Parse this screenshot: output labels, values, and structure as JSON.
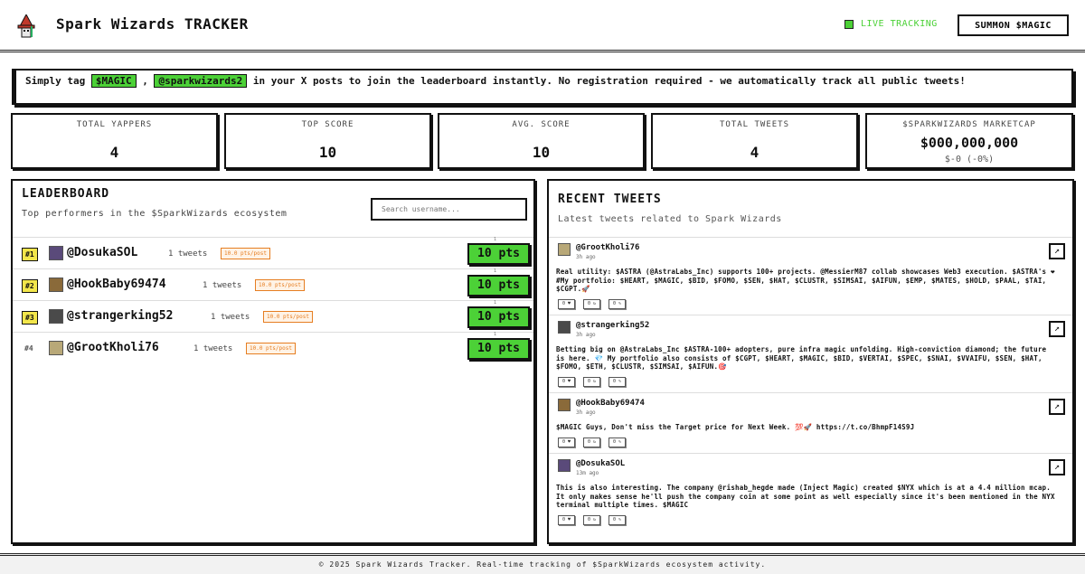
{
  "header": {
    "title": "Spark Wizards TRACKER",
    "live_label": "LIVE TRACKING",
    "summon_label": "SUMMON $MAGIC",
    "logo_icon": "wizard-icon"
  },
  "banner": {
    "part1": "Simply tag",
    "tag1": "$MAGIC",
    "sep": ",",
    "tag2": "@sparkwizards2",
    "part2": "in your X posts to join the leaderboard instantly. No registration required - we automatically track all public tweets!"
  },
  "stats": [
    {
      "label": "TOTAL YAPPERS",
      "value": "4"
    },
    {
      "label": "TOP SCORE",
      "value": "10"
    },
    {
      "label": "AVG. SCORE",
      "value": "10"
    },
    {
      "label": "TOTAL TWEETS",
      "value": "4"
    }
  ],
  "marketcap": {
    "label": "$SPARKWIZARDS MARKETCAP",
    "value": "$000,000,000",
    "change": "$-0 (-0%)"
  },
  "leaderboard": {
    "title": "LEADERBOARD",
    "subtitle": "Top performers in the $SparkWizards ecosystem",
    "search_placeholder": "Search username...",
    "rows": [
      {
        "rank": "#1",
        "user": "@DosukaSOL",
        "tweets": "1 tweets",
        "ppp": "10.0 pts/post",
        "pts": "10 pts",
        "tick": "1"
      },
      {
        "rank": "#2",
        "user": "@HookBaby69474",
        "tweets": "1 tweets",
        "ppp": "10.0 pts/post",
        "pts": "10 pts",
        "tick": "1"
      },
      {
        "rank": "#3",
        "user": "@strangerking52",
        "tweets": "1 tweets",
        "ppp": "10.0 pts/post",
        "pts": "10 pts",
        "tick": "1"
      },
      {
        "rank": "#4",
        "user": "@GrootKholi76",
        "tweets": "1 tweets",
        "ppp": "10.0 pts/post",
        "pts": "10 pts",
        "tick": "1"
      }
    ]
  },
  "recent": {
    "title": "RECENT TWEETS",
    "subtitle": "Latest tweets related to Spark Wizards",
    "tweets": [
      {
        "user": "@GrootKholi76",
        "time": "3h ago",
        "text": "Real utility: $ASTRA (@AstraLabs_Inc) supports 100+ projects. @MessierM87 collab showcases Web3 execution. $ASTRA's ❤ #My portfolio: $HEART, $MAGIC, $BID, $FOMO, $SEN, $HAT, $CLUSTR, $SIMSAI, $AIFUN, $EMP, $MATES, $HOLD, $PAAL, $TAI, $CGPT.🚀",
        "acts": [
          "0 ♥",
          "0 ↻",
          "0 ✎"
        ]
      },
      {
        "user": "@strangerking52",
        "time": "3h ago",
        "text": "Betting big on @AstraLabs_Inc $ASTRA-100+ adopters, pure infra magic unfolding. High-conviction diamond; the future is here. 💎 My portfolio also consists of $CGPT, $HEART, $MAGIC, $BID, $VERTAI, $SPEC, $SNAI, $VVAIFU, $SEN, $HAT, $FOMO, $ETH, $CLUSTR, $SIMSAI, $AIFUN.🎯",
        "acts": [
          "0 ♥",
          "0 ↻",
          "0 ✎"
        ]
      },
      {
        "user": "@HookBaby69474",
        "time": "3h ago",
        "text": "$MAGIC Guys, Don't miss the Target price for Next Week. 💯🚀 https://t.co/BhmpF14S9J",
        "acts": [
          "0 ♥",
          "0 ↻",
          "0 ✎"
        ]
      },
      {
        "user": "@DosukaSOL",
        "time": "13m ago",
        "text": "This is also interesting. The company @rishab_hegde made (Inject Magic) created $NYX which is at a 4.4 million mcap. It only makes sense he'll push the company coin at some point as well especially since it's been mentioned in the NYX terminal multiple times. $MAGIC",
        "acts": [
          "0 ♥",
          "0 ↻",
          "0 ✎"
        ]
      }
    ]
  },
  "footer": {
    "text": "© 2025 Spark Wizards Tracker. Real-time tracking of $SparkWizards ecosystem activity."
  },
  "colors": {
    "accent": "#4cd137",
    "rank_badge": "#f2e64b",
    "ppp": "#e67e22"
  }
}
